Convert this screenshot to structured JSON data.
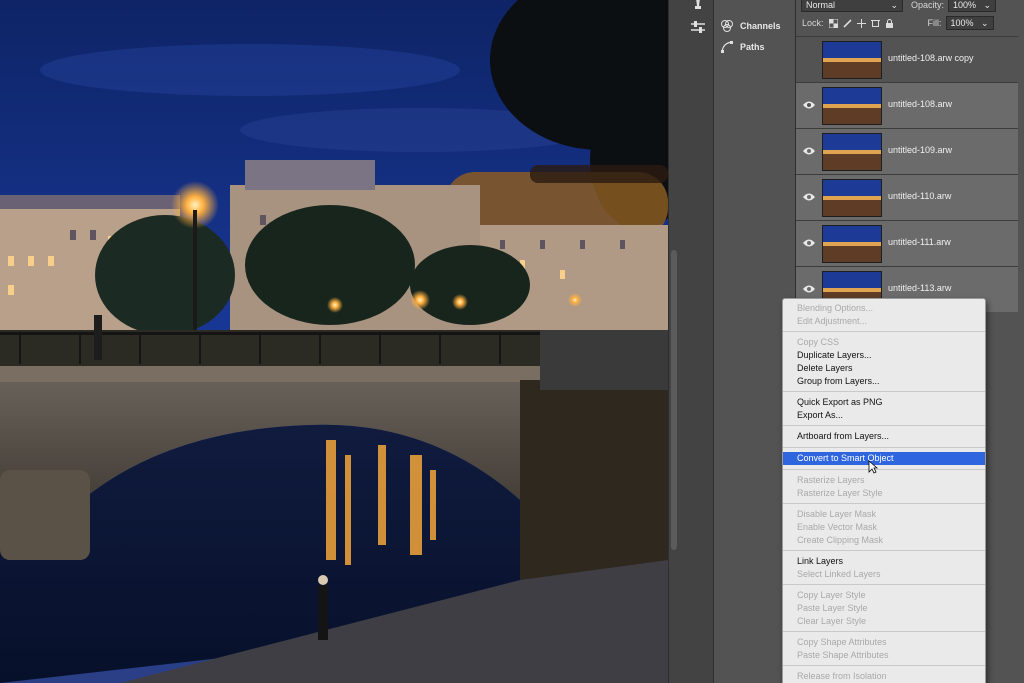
{
  "options_bar": {
    "blend_mode": "Normal",
    "opacity_label": "Opacity:",
    "opacity_value": "100%",
    "lock_label": "Lock:",
    "fill_label": "Fill:",
    "fill_value": "100%"
  },
  "side_panels": [
    {
      "label": "Channels",
      "icon": "channels-icon"
    },
    {
      "label": "Paths",
      "icon": "paths-icon"
    }
  ],
  "layers": [
    {
      "name": "untitled-108.arw copy",
      "visible": false,
      "selected": false
    },
    {
      "name": "untitled-108.arw",
      "visible": true,
      "selected": true
    },
    {
      "name": "untitled-109.arw",
      "visible": true,
      "selected": true
    },
    {
      "name": "untitled-110.arw",
      "visible": true,
      "selected": true
    },
    {
      "name": "untitled-111.arw",
      "visible": true,
      "selected": true
    },
    {
      "name": "untitled-113.arw",
      "visible": true,
      "selected": true
    }
  ],
  "context_menu": {
    "items": [
      {
        "label": "Blending Options...",
        "enabled": false
      },
      {
        "label": "Edit Adjustment...",
        "enabled": false
      },
      {
        "separator": true
      },
      {
        "label": "Copy CSS",
        "enabled": false
      },
      {
        "label": "Duplicate Layers...",
        "enabled": true
      },
      {
        "label": "Delete Layers",
        "enabled": true
      },
      {
        "label": "Group from Layers...",
        "enabled": true
      },
      {
        "separator": true
      },
      {
        "label": "Quick Export as PNG",
        "enabled": true
      },
      {
        "label": "Export As...",
        "enabled": true
      },
      {
        "separator": true
      },
      {
        "label": "Artboard from Layers...",
        "enabled": true
      },
      {
        "separator": true
      },
      {
        "label": "Convert to Smart Object",
        "enabled": true,
        "highlighted": true
      },
      {
        "separator": true
      },
      {
        "label": "Rasterize Layers",
        "enabled": false
      },
      {
        "label": "Rasterize Layer Style",
        "enabled": false
      },
      {
        "separator": true
      },
      {
        "label": "Disable Layer Mask",
        "enabled": false
      },
      {
        "label": "Enable Vector Mask",
        "enabled": false
      },
      {
        "label": "Create Clipping Mask",
        "enabled": false
      },
      {
        "separator": true
      },
      {
        "label": "Link Layers",
        "enabled": true
      },
      {
        "label": "Select Linked Layers",
        "enabled": false
      },
      {
        "separator": true
      },
      {
        "label": "Copy Layer Style",
        "enabled": false
      },
      {
        "label": "Paste Layer Style",
        "enabled": false
      },
      {
        "label": "Clear Layer Style",
        "enabled": false
      },
      {
        "separator": true
      },
      {
        "label": "Copy Shape Attributes",
        "enabled": false
      },
      {
        "label": "Paste Shape Attributes",
        "enabled": false
      },
      {
        "separator": true
      },
      {
        "label": "Release from Isolation",
        "enabled": false
      }
    ]
  },
  "colors": {
    "panel_bg": "#535353",
    "selected_layer": "#6b6b6b",
    "menu_bg": "#eaeaea",
    "menu_highlight": "#2f66e0",
    "sky": "#14307a",
    "lamp_glow": "#ffb040"
  }
}
